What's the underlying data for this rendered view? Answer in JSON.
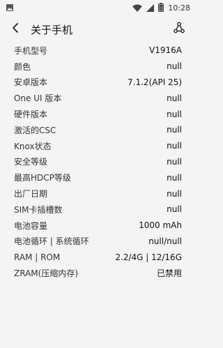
{
  "status_bar": {
    "time": "10:28",
    "icons": [
      "image-icon",
      "wifi-icon",
      "signal-icon",
      "battery-icon"
    ]
  },
  "toolbar": {
    "title": "关于手机",
    "back_icon": "chevron-left-icon",
    "share_icon": "share-icon"
  },
  "rows": [
    {
      "label": "手机型号",
      "value": "V1916A"
    },
    {
      "label": "颜色",
      "value": "null"
    },
    {
      "label": "安卓版本",
      "value": "7.1.2(API 25)"
    },
    {
      "label": "One UI 版本",
      "value": "null"
    },
    {
      "label": "硬件版本",
      "value": "null"
    },
    {
      "label": "激活的CSC",
      "value": "null"
    },
    {
      "label": "Knox状态",
      "value": "null"
    },
    {
      "label": "安全等级",
      "value": "null"
    },
    {
      "label": "最高HDCP等级",
      "value": "null"
    },
    {
      "label": "出厂日期",
      "value": "null"
    },
    {
      "label": "SIM卡插槽数",
      "value": "null"
    },
    {
      "label": "电池容量",
      "value": "1000 mAh"
    },
    {
      "label": "电池循环 | 系统循环",
      "value": "null/null"
    },
    {
      "label": "RAM | ROM",
      "value": "2.2/4G | 12/16G"
    },
    {
      "label": "ZRAM(压缩内存)",
      "value": "已禁用"
    }
  ]
}
